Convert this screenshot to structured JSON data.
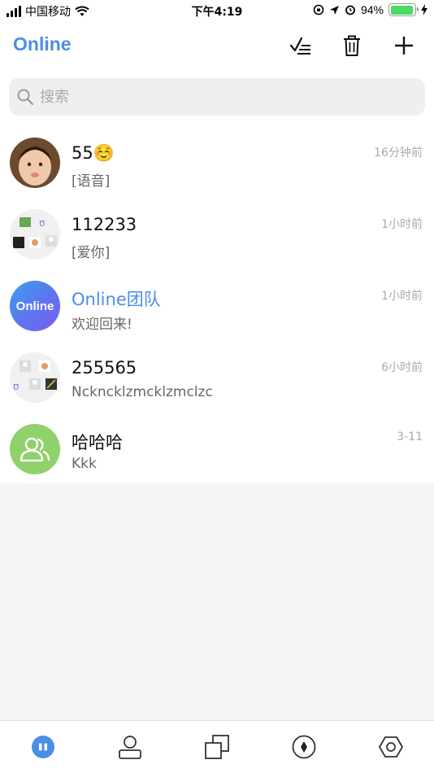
{
  "status_bar": {
    "carrier": "中国移动",
    "time": "下午4:19",
    "battery_percent": "94%",
    "battery_level": 0.94,
    "icons": [
      "signal-icon",
      "wifi-icon",
      "orientation-lock-icon",
      "location-arrow-icon",
      "alarm-icon",
      "battery-icon",
      "charging-icon"
    ]
  },
  "header": {
    "title": "Online",
    "actions": [
      "multi-select-icon",
      "trash-icon",
      "plus-icon"
    ]
  },
  "search": {
    "placeholder": "搜索"
  },
  "chats": [
    {
      "name": "55☺️",
      "preview": "[语音]",
      "time": "16分钟前",
      "avatar": "baby-photo"
    },
    {
      "name": "112233",
      "preview": "[爱你]",
      "time": "1小时前",
      "avatar": "group-collage"
    },
    {
      "name": "Online团队",
      "preview": "欢迎回来!",
      "time": "1小时前",
      "avatar": "online-logo",
      "avatar_text": "Online"
    },
    {
      "name": "255565",
      "preview": "Nckncklzmcklzmclzc",
      "time": "6小时前",
      "avatar": "group-collage"
    },
    {
      "name": "哈哈哈",
      "preview": "Kkk",
      "time": "3-11",
      "avatar": "group-icon"
    }
  ],
  "tab_bar": {
    "items": [
      "chats-icon",
      "contacts-icon",
      "groups-icon",
      "discover-icon",
      "settings-icon"
    ],
    "active_index": 0
  },
  "colors": {
    "accent": "#4a8ee6",
    "group_avatar": "#8fd16a",
    "team_gradient_start": "#3aa0f0",
    "team_gradient_end": "#7b5cf0"
  }
}
